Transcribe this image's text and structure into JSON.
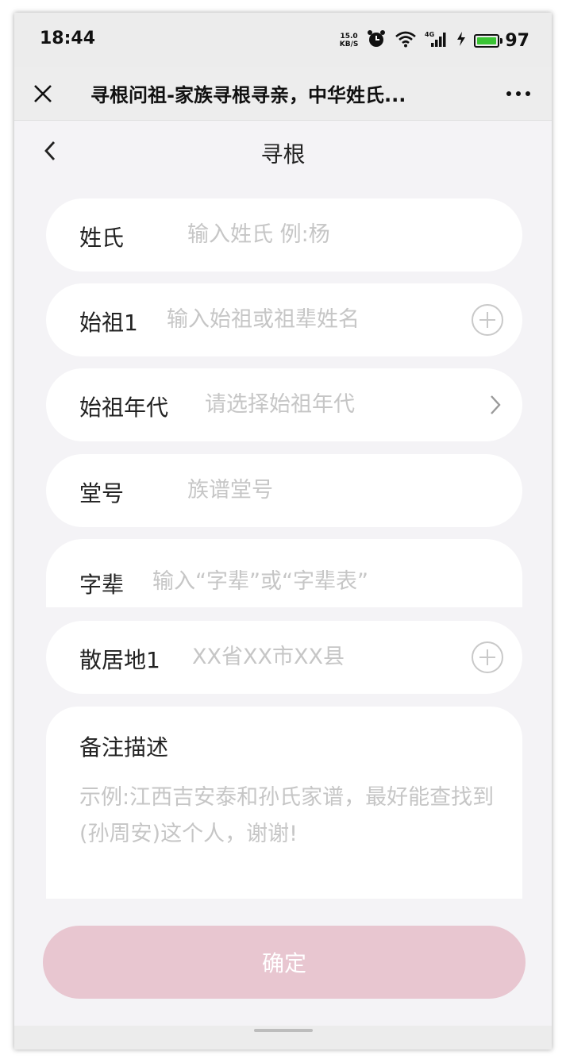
{
  "status_bar": {
    "time": "18:44",
    "net_speed_value": "15.0",
    "net_speed_unit": "KB/S",
    "signal_type": "4G",
    "battery_level": "97",
    "battery_color": "#3ac434"
  },
  "browser": {
    "title": "寻根问祖-家族寻根寻亲，中华姓氏...",
    "close_icon": "close-icon",
    "more_icon": "more-icon"
  },
  "nav": {
    "title": "寻根",
    "back_icon": "chevron-left-icon"
  },
  "form": {
    "surname": {
      "label": "姓氏",
      "placeholder": "输入姓氏 例:杨"
    },
    "ancestor": {
      "label": "始祖1",
      "placeholder": "输入始祖或祖辈姓名"
    },
    "ancestor_era": {
      "label": "始祖年代",
      "placeholder": "请选择始祖年代"
    },
    "hall_name": {
      "label": "堂号",
      "placeholder": "族谱堂号"
    },
    "generation": {
      "label": "字辈",
      "placeholder": "输入“字辈”或“字辈表”"
    },
    "residence": {
      "label": "散居地1",
      "placeholder": "XX省XX市XX县"
    },
    "remark": {
      "label": "备注描述",
      "placeholder": "示例:江西吉安泰和孙氏家谱，最好能查找到(孙周安)这个人，谢谢!"
    }
  },
  "confirm_label": "确定",
  "colors": {
    "page_background": "#f4f3f6",
    "confirm_button": "#e8c6d0",
    "placeholder_text": "#c6c6c6"
  }
}
